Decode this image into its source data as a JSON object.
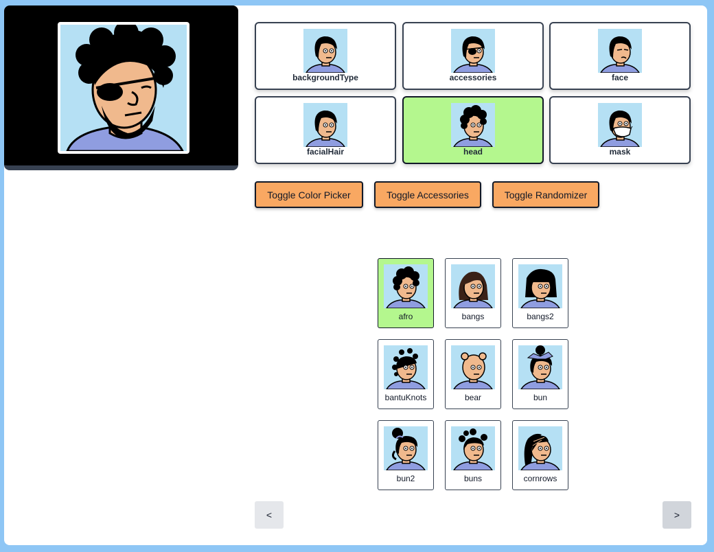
{
  "categories": [
    {
      "label": "backgroundType",
      "selected": false
    },
    {
      "label": "accessories",
      "selected": false
    },
    {
      "label": "face",
      "selected": false
    },
    {
      "label": "facialHair",
      "selected": false
    },
    {
      "label": "head",
      "selected": true
    },
    {
      "label": "mask",
      "selected": false
    }
  ],
  "toggles": {
    "color_picker": "Toggle Color Picker",
    "accessories": "Toggle Accessories",
    "randomizer": "Toggle Randomizer"
  },
  "options": [
    {
      "label": "afro",
      "selected": true
    },
    {
      "label": "bangs",
      "selected": false
    },
    {
      "label": "bangs2",
      "selected": false
    },
    {
      "label": "bantuKnots",
      "selected": false
    },
    {
      "label": "bear",
      "selected": false
    },
    {
      "label": "bun",
      "selected": false
    },
    {
      "label": "bun2",
      "selected": false
    },
    {
      "label": "buns",
      "selected": false
    },
    {
      "label": "cornrows",
      "selected": false
    }
  ],
  "pagination": {
    "prev": "<",
    "next": ">"
  },
  "colors": {
    "page_bg": "#8ec6f5",
    "selected": "#b4f78e",
    "button": "#f9a862",
    "avatar_bg": "#b5e0f4",
    "skin": "#f0b98d",
    "shirt": "#8f9de0"
  }
}
